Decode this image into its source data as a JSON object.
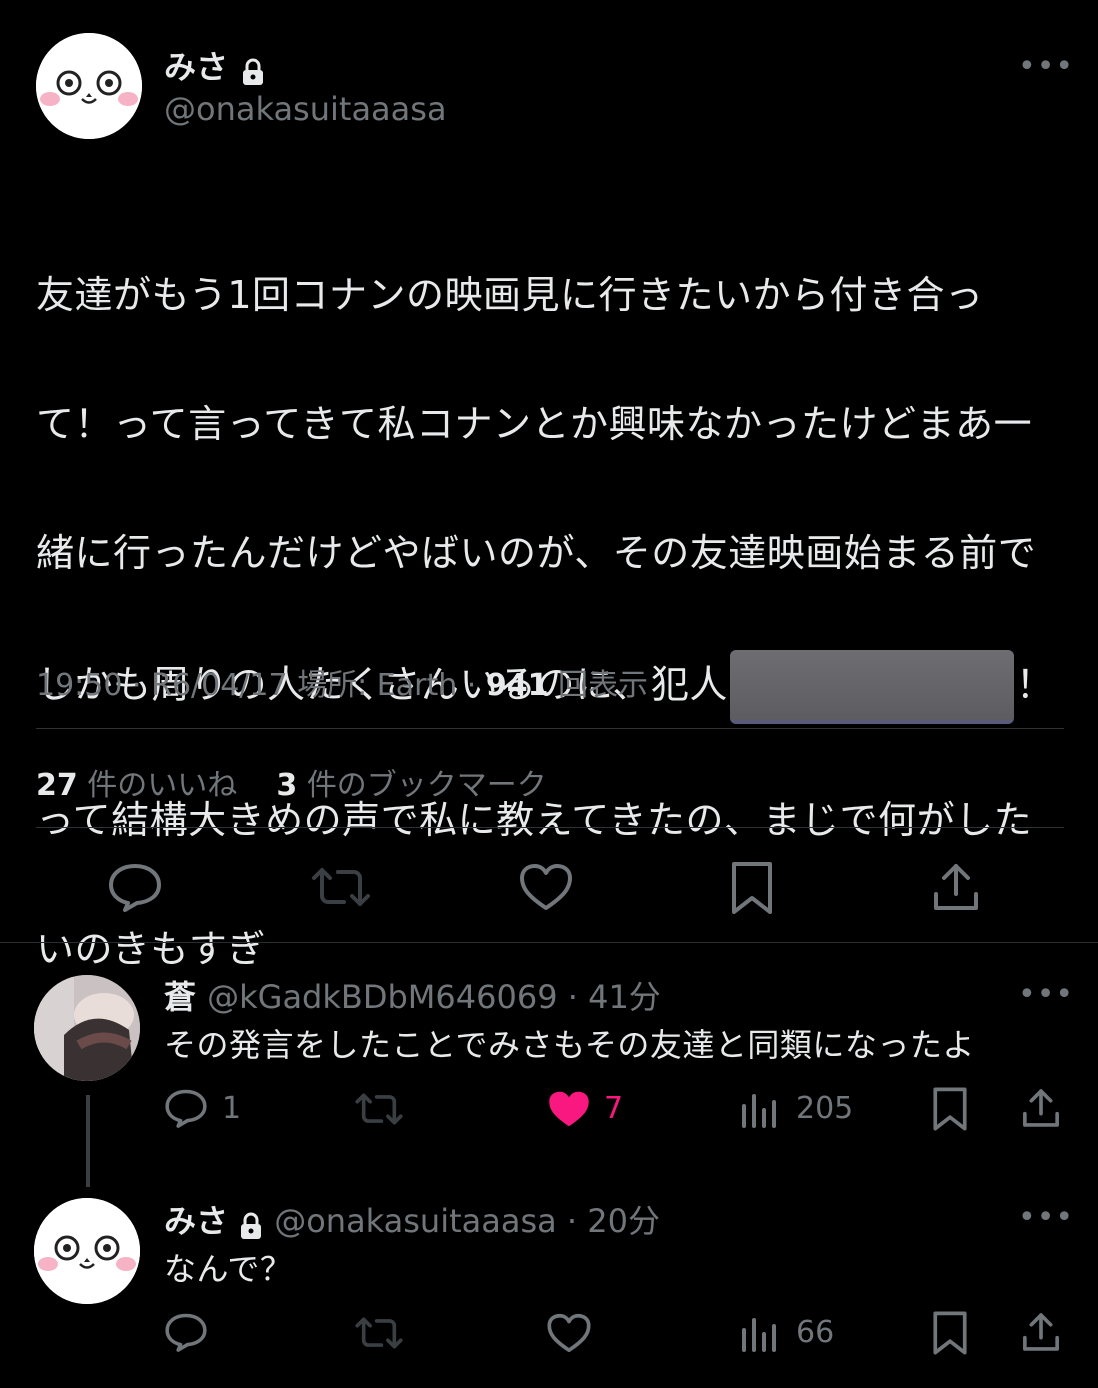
{
  "post": {
    "author_name": "みさ",
    "author_handle": "@onakasuitaaasa",
    "text_lines": [
      "友達がもう1回コナンの映画見に行きたいから付き合っ",
      "て！って言ってきて私コナンとか興味なかったけどまあ一",
      "緒に行ったんだけどやばいのが、その友達映画始まる前で",
      "しかも周りの人たくさんいるのに、犯人",
      "！",
      "って結構大きめの声で私に教えてきたの、まじで何がした",
      "いのきもすぎ"
    ],
    "time": "19:50",
    "date": "R6/04/17",
    "location": "場所: Earth",
    "views_count": "941",
    "views_label": "回表示",
    "likes_count": "27",
    "likes_label": "件のいいね",
    "bookmarks_count": "3",
    "bookmarks_label": "件のブックマーク"
  },
  "reply1": {
    "name": "蒼",
    "handle": "@kGadkBDbM646069",
    "time": "41分",
    "text": "その発言をしたことでみさもその友達と同類になったよ",
    "replies": "1",
    "likes": "7",
    "views": "205"
  },
  "reply2": {
    "name": "みさ",
    "handle": "@onakasuitaaasa",
    "time": "20分",
    "text": "なんで？",
    "views": "66"
  },
  "colors": {
    "background": "#000000",
    "text": "#e7e9ea",
    "secondary": "#71767b",
    "like_active": "#f91880"
  },
  "icons": [
    "lock-icon",
    "more-icon",
    "reply-icon",
    "retweet-icon",
    "like-icon",
    "bookmark-icon",
    "share-icon",
    "views-icon"
  ]
}
